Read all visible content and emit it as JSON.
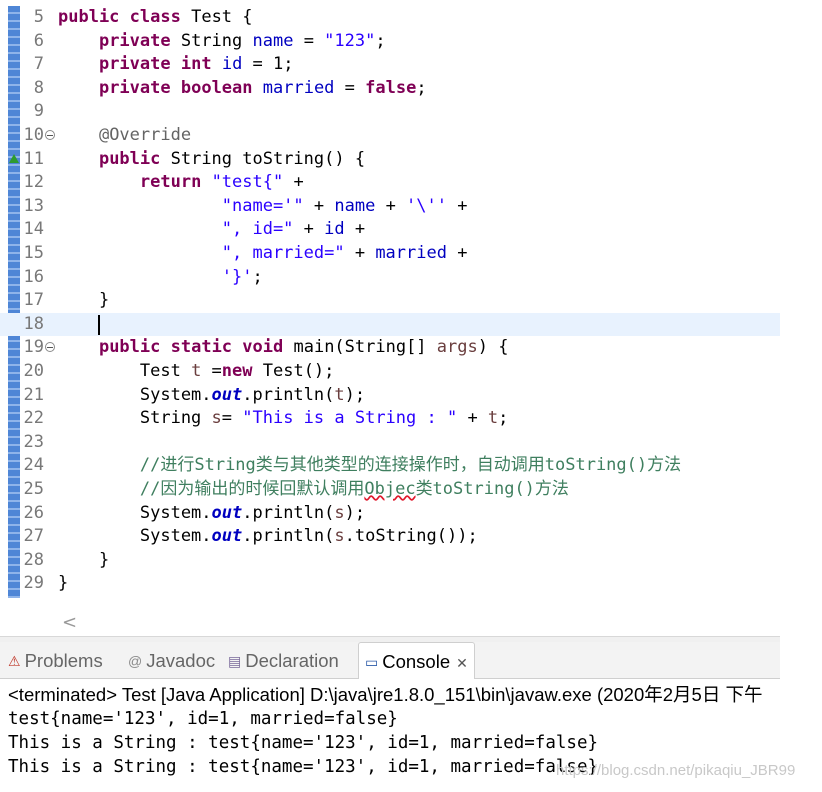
{
  "editor": {
    "current_line": "18",
    "lines": [
      {
        "n": "5",
        "tokens": [
          [
            "keyword",
            "public"
          ],
          [
            "plain",
            " "
          ],
          [
            "keyword",
            "class"
          ],
          [
            "plain",
            " Test {"
          ]
        ]
      },
      {
        "n": "6",
        "tokens": [
          [
            "plain",
            "    "
          ],
          [
            "keyword",
            "private"
          ],
          [
            "plain",
            " String "
          ],
          [
            "field",
            "name"
          ],
          [
            "plain",
            " = "
          ],
          [
            "string",
            "\"123\""
          ],
          [
            "plain",
            ";"
          ]
        ]
      },
      {
        "n": "7",
        "tokens": [
          [
            "plain",
            "    "
          ],
          [
            "keyword",
            "private"
          ],
          [
            "plain",
            " "
          ],
          [
            "keyword",
            "int"
          ],
          [
            "plain",
            " "
          ],
          [
            "field",
            "id"
          ],
          [
            "plain",
            " = 1;"
          ]
        ]
      },
      {
        "n": "8",
        "tokens": [
          [
            "plain",
            "    "
          ],
          [
            "keyword",
            "private"
          ],
          [
            "plain",
            " "
          ],
          [
            "keyword",
            "boolean"
          ],
          [
            "plain",
            " "
          ],
          [
            "field",
            "married"
          ],
          [
            "plain",
            " = "
          ],
          [
            "keyword",
            "false"
          ],
          [
            "plain",
            ";"
          ]
        ]
      },
      {
        "n": "9",
        "tokens": []
      },
      {
        "n": "10",
        "fold": true,
        "tokens": [
          [
            "plain",
            "    "
          ],
          [
            "annotation",
            "@Override"
          ]
        ]
      },
      {
        "n": "11",
        "override": true,
        "tokens": [
          [
            "plain",
            "    "
          ],
          [
            "keyword",
            "public"
          ],
          [
            "plain",
            " String toString() {"
          ]
        ]
      },
      {
        "n": "12",
        "tokens": [
          [
            "plain",
            "        "
          ],
          [
            "keyword",
            "return"
          ],
          [
            "plain",
            " "
          ],
          [
            "string",
            "\"test{\""
          ],
          [
            "plain",
            " +"
          ]
        ]
      },
      {
        "n": "13",
        "tokens": [
          [
            "plain",
            "                "
          ],
          [
            "string",
            "\"name='\""
          ],
          [
            "plain",
            " + "
          ],
          [
            "field",
            "name"
          ],
          [
            "plain",
            " + "
          ],
          [
            "string",
            "'\\''"
          ],
          [
            "plain",
            " +"
          ]
        ]
      },
      {
        "n": "14",
        "tokens": [
          [
            "plain",
            "                "
          ],
          [
            "string",
            "\", id=\""
          ],
          [
            "plain",
            " + "
          ],
          [
            "field",
            "id"
          ],
          [
            "plain",
            " +"
          ]
        ]
      },
      {
        "n": "15",
        "tokens": [
          [
            "plain",
            "                "
          ],
          [
            "string",
            "\", married=\""
          ],
          [
            "plain",
            " + "
          ],
          [
            "field",
            "married"
          ],
          [
            "plain",
            " +"
          ]
        ]
      },
      {
        "n": "16",
        "tokens": [
          [
            "plain",
            "                "
          ],
          [
            "string",
            "'}'"
          ],
          [
            "plain",
            ";"
          ]
        ]
      },
      {
        "n": "17",
        "tokens": [
          [
            "plain",
            "    }"
          ]
        ]
      },
      {
        "n": "18",
        "tokens": []
      },
      {
        "n": "19",
        "fold": true,
        "tokens": [
          [
            "plain",
            "    "
          ],
          [
            "keyword",
            "public"
          ],
          [
            "plain",
            " "
          ],
          [
            "keyword",
            "static"
          ],
          [
            "plain",
            " "
          ],
          [
            "keyword",
            "void"
          ],
          [
            "plain",
            " main(String[] "
          ],
          [
            "local",
            "args"
          ],
          [
            "plain",
            ") {"
          ]
        ]
      },
      {
        "n": "20",
        "tokens": [
          [
            "plain",
            "        Test "
          ],
          [
            "local",
            "t"
          ],
          [
            "plain",
            " ="
          ],
          [
            "keyword",
            "new"
          ],
          [
            "plain",
            " Test();"
          ]
        ]
      },
      {
        "n": "21",
        "tokens": [
          [
            "plain",
            "        System."
          ],
          [
            "static",
            "out"
          ],
          [
            "plain",
            ".println("
          ],
          [
            "local",
            "t"
          ],
          [
            "plain",
            ");"
          ]
        ]
      },
      {
        "n": "22",
        "tokens": [
          [
            "plain",
            "        String "
          ],
          [
            "local",
            "s"
          ],
          [
            "plain",
            "= "
          ],
          [
            "string",
            "\"This is a String : \""
          ],
          [
            "plain",
            " + "
          ],
          [
            "local",
            "t"
          ],
          [
            "plain",
            ";"
          ]
        ]
      },
      {
        "n": "23",
        "tokens": []
      },
      {
        "n": "24",
        "tokens": [
          [
            "plain",
            "        "
          ],
          [
            "comment",
            "//进行String类与其他类型的连接操作时，自动调用toString()方法"
          ]
        ]
      },
      {
        "n": "25",
        "tokens": [
          [
            "plain",
            "        "
          ],
          [
            "comment",
            "//因为输出的时候回默认调用"
          ],
          [
            "comment-squiggle",
            "Objec"
          ],
          [
            "comment",
            "类toString()方法"
          ]
        ]
      },
      {
        "n": "26",
        "tokens": [
          [
            "plain",
            "        System."
          ],
          [
            "static",
            "out"
          ],
          [
            "plain",
            ".println("
          ],
          [
            "local",
            "s"
          ],
          [
            "plain",
            ");"
          ]
        ]
      },
      {
        "n": "27",
        "tokens": [
          [
            "plain",
            "        System."
          ],
          [
            "static",
            "out"
          ],
          [
            "plain",
            ".println("
          ],
          [
            "local",
            "s"
          ],
          [
            "plain",
            ".toString());"
          ]
        ]
      },
      {
        "n": "28",
        "tokens": [
          [
            "plain",
            "    }"
          ]
        ]
      },
      {
        "n": "29",
        "tokens": [
          [
            "plain",
            "}"
          ]
        ]
      }
    ]
  },
  "scroll": {
    "left_arrow": "<"
  },
  "tabs": [
    {
      "label": "Problems",
      "icon": "problems-icon",
      "glyph": "⚠",
      "color": "#c0392b",
      "active": false
    },
    {
      "label": "Javadoc",
      "icon": "javadoc-icon",
      "glyph": "@",
      "color": "#8a8a8a",
      "active": false
    },
    {
      "label": "Declaration",
      "icon": "declaration-icon",
      "glyph": "▤",
      "color": "#7a6a9a",
      "active": false
    },
    {
      "label": "Console",
      "icon": "console-icon",
      "glyph": "▭",
      "color": "#2b5aa8",
      "active": true,
      "close": "✕"
    }
  ],
  "console": {
    "status": "<terminated> Test [Java Application] D:\\java\\jre1.8.0_151\\bin\\javaw.exe (2020年2月5日 下午",
    "output": [
      "test{name='123', id=1, married=false}",
      "This is a String : test{name='123', id=1, married=false}",
      "This is a String : test{name='123', id=1, married=false}"
    ]
  },
  "watermark": "https://blog.csdn.net/pikaqiu_JBR99"
}
